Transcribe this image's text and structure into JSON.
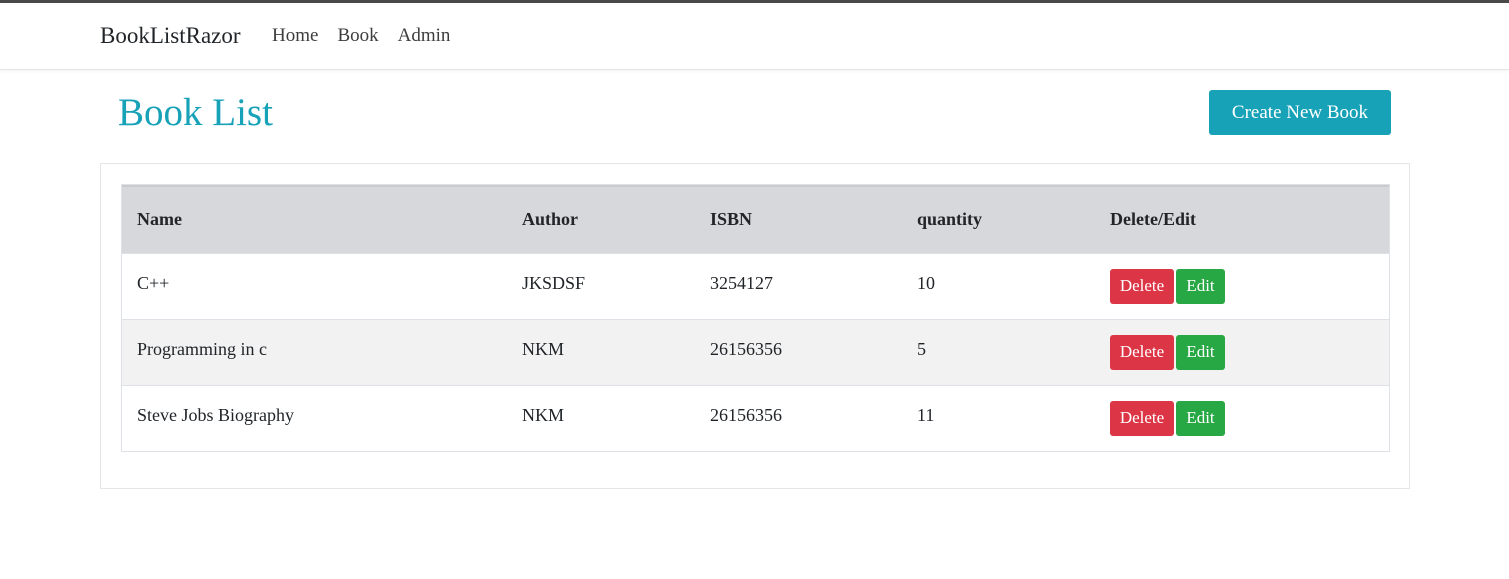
{
  "navbar": {
    "brand": "BookListRazor",
    "links": [
      "Home",
      "Book",
      "Admin"
    ]
  },
  "page": {
    "title": "Book List",
    "create_button": "Create New Book"
  },
  "table": {
    "headers": [
      "Name",
      "Author",
      "ISBN",
      "quantity",
      "Delete/Edit"
    ],
    "rows": [
      {
        "name": "C++",
        "author": "JKSDSF",
        "isbn": "3254127",
        "quantity": "10"
      },
      {
        "name": "Programming in c",
        "author": "NKM",
        "isbn": "26156356",
        "quantity": "5"
      },
      {
        "name": "Steve Jobs Biography",
        "author": "NKM",
        "isbn": "26156356",
        "quantity": "11"
      }
    ],
    "delete_label": "Delete",
    "edit_label": "Edit"
  },
  "colors": {
    "accent": "#17a2b8",
    "danger": "#dc3545",
    "success": "#28a745",
    "header_bg": "#d6d8db"
  }
}
